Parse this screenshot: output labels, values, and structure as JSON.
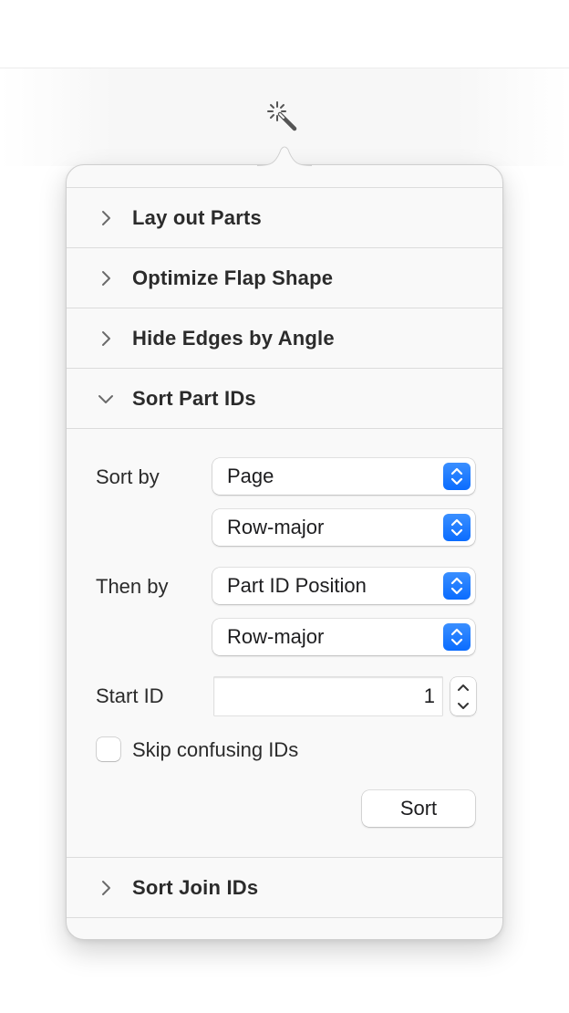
{
  "toolbar": {
    "tool_icon": "magic-wand-icon"
  },
  "sections": [
    {
      "title": "Lay out Parts",
      "expanded": false
    },
    {
      "title": "Optimize Flap Shape",
      "expanded": false
    },
    {
      "title": "Hide Edges by Angle",
      "expanded": false
    },
    {
      "title": "Sort Part IDs",
      "expanded": true
    },
    {
      "title": "Sort Join IDs",
      "expanded": false
    }
  ],
  "sort_part_ids": {
    "sort_by_label": "Sort by",
    "sort_by_primary": "Page",
    "sort_by_secondary": "Row-major",
    "then_by_label": "Then by",
    "then_by_primary": "Part ID Position",
    "then_by_secondary": "Row-major",
    "start_id_label": "Start ID",
    "start_id_value": "1",
    "skip_confusing_label": "Skip confusing IDs",
    "skip_confusing_checked": false,
    "sort_button": "Sort"
  },
  "colors": {
    "accent": "#0a6cff",
    "popover_bg": "#f9f9f9"
  }
}
